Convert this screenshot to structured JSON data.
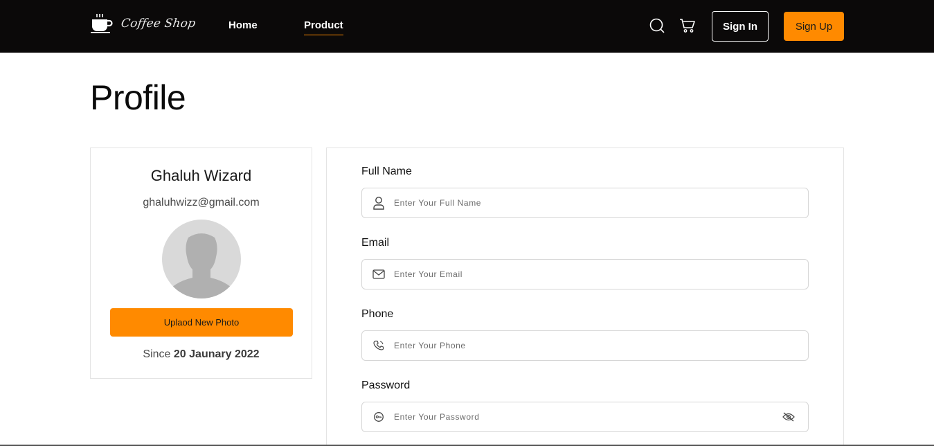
{
  "brand": {
    "name": "Coffee Shop"
  },
  "nav": {
    "links": [
      "Home",
      "Product"
    ],
    "active": "Product",
    "signin_label": "Sign In",
    "signup_label": "Sign Up"
  },
  "page": {
    "title": "Profile"
  },
  "profile": {
    "name": "Ghaluh Wizard",
    "email": "ghaluhwizz@gmail.com",
    "upload_label": "Uplaod New Photo",
    "since_prefix": "Since",
    "since_date": "20 Jaunary 2022"
  },
  "form": {
    "fields": [
      {
        "label": "Full Name",
        "placeholder": "Enter Your Full Name",
        "icon": "user-icon"
      },
      {
        "label": "Email",
        "placeholder": "Enter Your Email",
        "icon": "mail-icon"
      },
      {
        "label": "Phone",
        "placeholder": "Enter Your Phone",
        "icon": "phone-icon"
      },
      {
        "label": "Password",
        "placeholder": "Enter Your Password",
        "icon": "key-icon"
      }
    ]
  },
  "colors": {
    "accent": "#ff8a00",
    "navbar": "#0b0909",
    "border": "#e4e4e4"
  }
}
